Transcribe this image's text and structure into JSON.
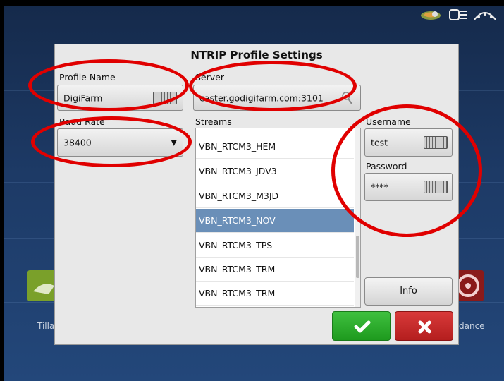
{
  "dialog": {
    "title": "NTRIP Profile Settings",
    "profile_name_label": "Profile Name",
    "profile_name_value": "DigiFarm",
    "server_label": "Server",
    "server_value": "caster.godigifarm.com:3101",
    "baud_rate_label": "Baud Rate",
    "baud_rate_value": "38400",
    "streams_label": "Streams",
    "streams": [
      {
        "label": "VBN_RTCM3_HEM",
        "selected": false
      },
      {
        "label": "VBN_RTCM3_JDV3",
        "selected": false
      },
      {
        "label": "VBN_RTCM3_M3JD",
        "selected": false
      },
      {
        "label": "VBN_RTCM3_NOV",
        "selected": true
      },
      {
        "label": "VBN_RTCM3_TPS",
        "selected": false
      },
      {
        "label": "VBN_RTCM3_TRM",
        "selected": false
      },
      {
        "label": "VBN_RTCM3_TRM",
        "selected": false
      }
    ],
    "username_label": "Username",
    "username_value": "test",
    "password_label": "Password",
    "password_value": "****",
    "info_label": "Info"
  },
  "background": {
    "left_tile_label": "Tilla",
    "right_tile_label": "dance"
  },
  "colors": {
    "selected_row": "#6a8fb8",
    "ok_button": "#2aad2a",
    "cancel_button": "#c62a2a",
    "annotation": "#e00000"
  },
  "icons": [
    "keyboard-icon",
    "wrench-icon",
    "dropdown-caret-icon",
    "checkmark-icon",
    "x-icon",
    "gps-status-icon",
    "satellite-icon"
  ]
}
